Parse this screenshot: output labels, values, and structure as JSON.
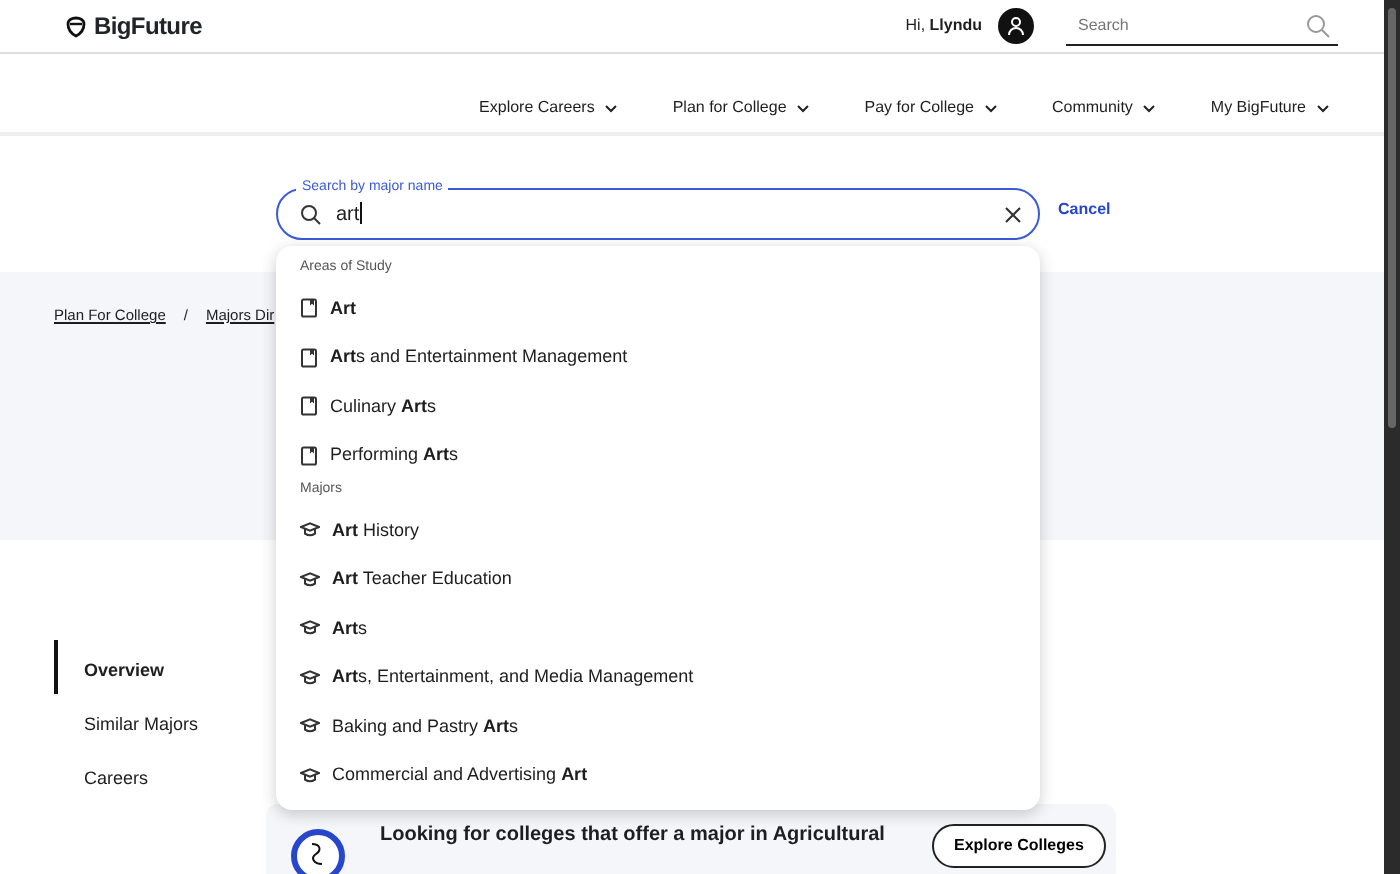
{
  "header": {
    "logo": "BigFuture",
    "greeting": "Hi,",
    "user": "Llyndu",
    "search": {
      "placeholder": "Search"
    }
  },
  "nav": [
    {
      "label": "Explore Careers"
    },
    {
      "label": "Plan for College"
    },
    {
      "label": "Pay for College"
    },
    {
      "label": "Community"
    },
    {
      "label": "My BigFuture"
    }
  ],
  "major_search": {
    "label": "Search by major name",
    "value": "art",
    "cancel": "Cancel"
  },
  "suggestions": [
    {
      "heading": "Areas of Study",
      "kind": "area",
      "items": [
        "**Art**",
        "**Art**s and Entertainment Management",
        "Culinary **Art**s",
        "Performing **Art**s"
      ]
    },
    {
      "heading": "Majors",
      "kind": "major",
      "items": [
        "**Art** History",
        "**Art** Teacher Education",
        "**Art**s",
        "**Art**s, Entertainment, and Media Management",
        "Baking and Pastry **Art**s",
        "Commercial and Advertising **Art**"
      ]
    }
  ],
  "breadcrumb": [
    {
      "label": "Plan For College"
    },
    {
      "label": "Majors Dir"
    }
  ],
  "breadcrumb_separator": "/",
  "side_nav": [
    {
      "label": "Overview",
      "selected": true
    },
    {
      "label": "Similar Majors",
      "selected": false
    },
    {
      "label": "Careers",
      "selected": false
    }
  ],
  "promo": {
    "text": "Looking for colleges that offer a major in Agricultural",
    "button": "Explore Colleges"
  }
}
